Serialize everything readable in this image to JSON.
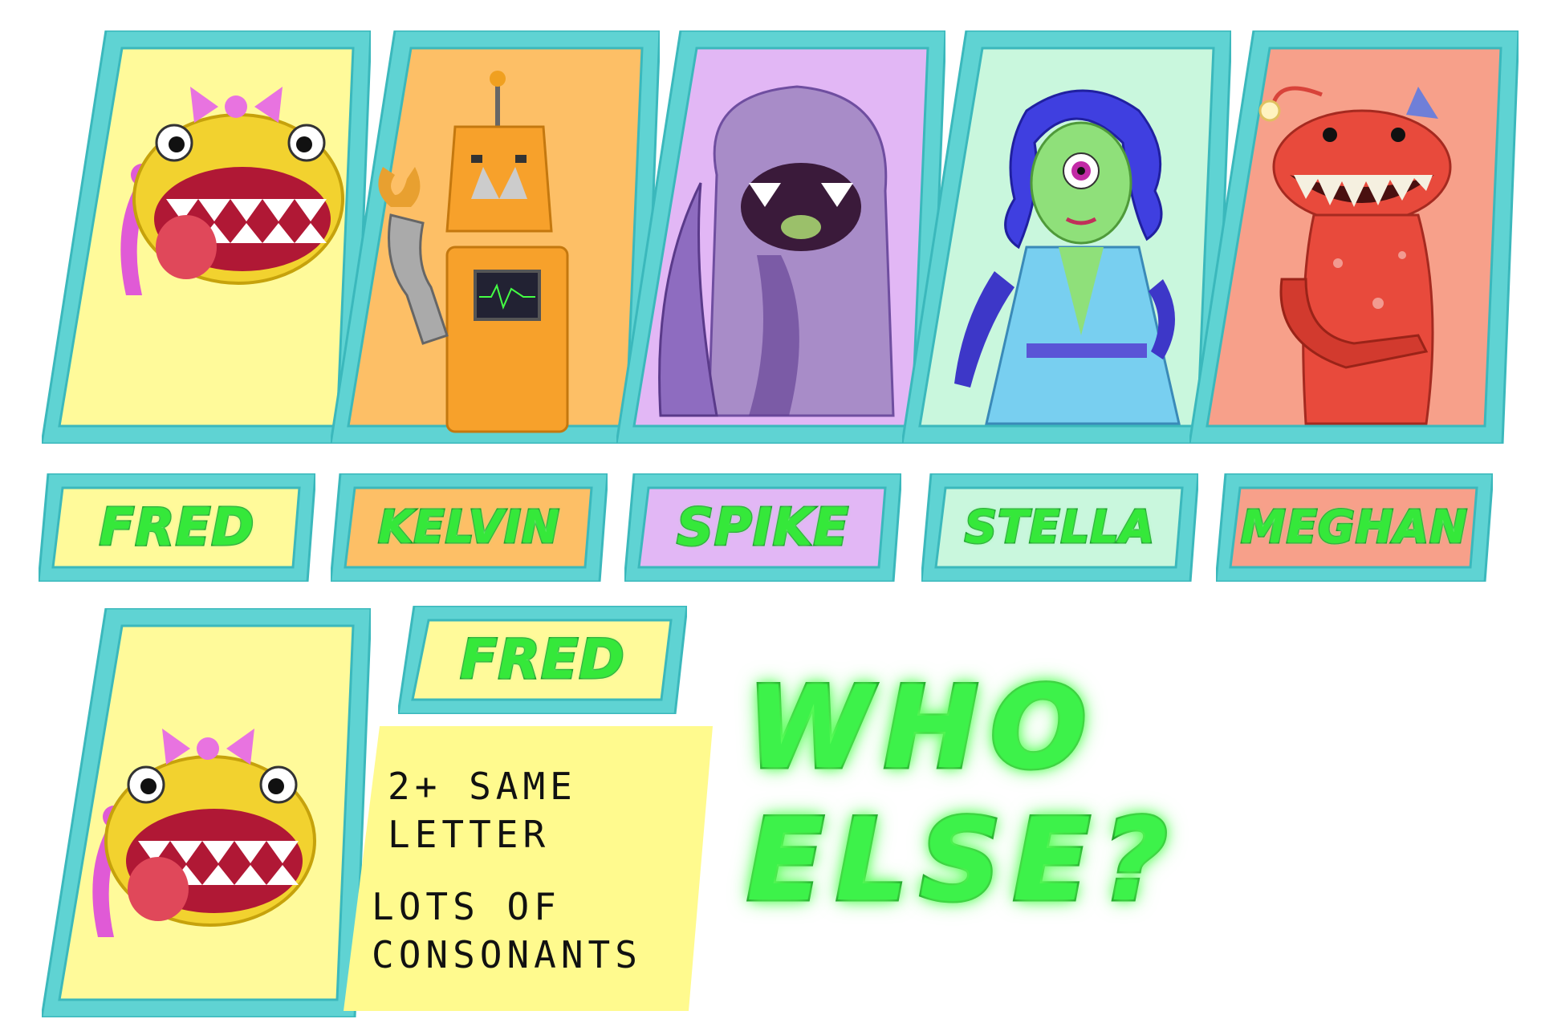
{
  "colors": {
    "frame": "#5fd3d3",
    "frame_border": "#3bb8bc",
    "name_fill": "#35e83a",
    "name_stroke": "#0a8f1e",
    "note_bg": "#fffa8e"
  },
  "characters": [
    {
      "name": "FRED",
      "bg": "#fffa9a",
      "icon": "pink-bowed-yellow-fish-monster-icon"
    },
    {
      "name": "KELVIN",
      "bg": "#fdbf66",
      "icon": "orange-robot-icon"
    },
    {
      "name": "SPIKE",
      "bg": "#e2b7f5",
      "icon": "purple-tentacle-monster-icon"
    },
    {
      "name": "STELLA",
      "bg": "#c9f7dd",
      "icon": "cyclops-lady-icon"
    },
    {
      "name": "MEGHAN",
      "bg": "#f7a08a",
      "icon": "anglerfish-monster-icon"
    }
  ],
  "selected": {
    "name": "FRED",
    "bg": "#fffa9a",
    "hints": [
      "2+ SAME\nLETTER",
      "LOTS OF\nCONSONANTS"
    ]
  },
  "prompt": "WHO ELSE?"
}
